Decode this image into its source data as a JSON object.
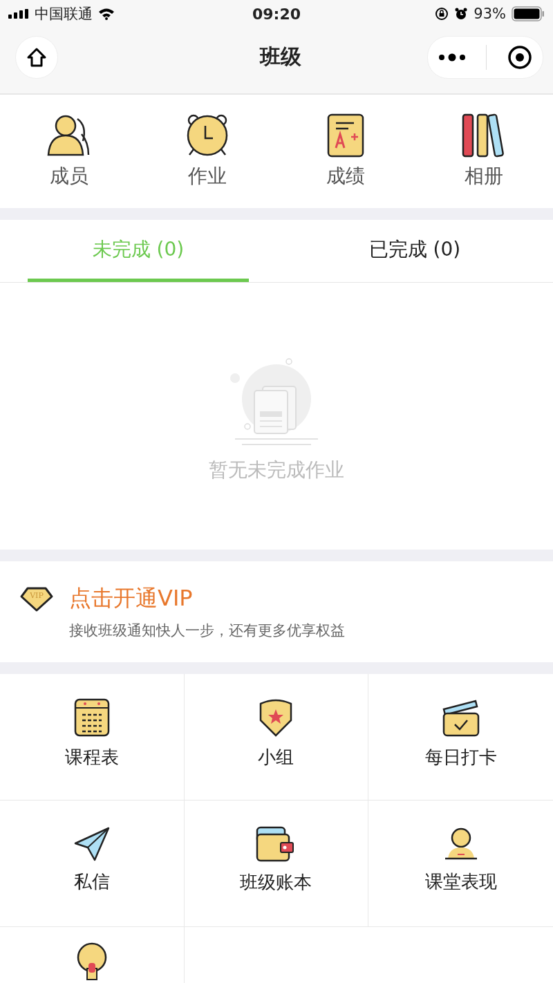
{
  "status_bar": {
    "carrier": "中国联通",
    "time": "09:20",
    "battery": "93%"
  },
  "nav": {
    "title": "班级"
  },
  "shortcuts": [
    {
      "label": "成员"
    },
    {
      "label": "作业"
    },
    {
      "label": "成绩"
    },
    {
      "label": "相册"
    }
  ],
  "tabs": [
    {
      "label": "未完成 (0)",
      "selected": true
    },
    {
      "label": "已完成 (0)",
      "selected": false
    }
  ],
  "empty_state": {
    "message": "暂无未完成作业"
  },
  "vip": {
    "badge": "VIP",
    "title": "点击开通VIP",
    "subtitle": "接收班级通知快人一步，还有更多优享权益"
  },
  "grid": [
    {
      "label": "课程表"
    },
    {
      "label": "小组"
    },
    {
      "label": "每日打卡"
    },
    {
      "label": "私信"
    },
    {
      "label": "班级账本"
    },
    {
      "label": "课堂表现"
    }
  ]
}
